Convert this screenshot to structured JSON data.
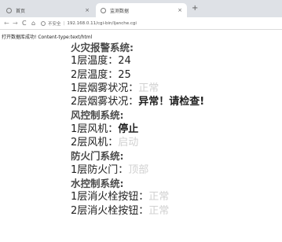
{
  "tabs": [
    {
      "title": "首页",
      "close": "×"
    },
    {
      "title": "监测数据",
      "close": "×"
    }
  ],
  "new_tab": "+",
  "toolbar": {
    "back": "←",
    "forward": "→",
    "reload": "C",
    "home": "⌂",
    "security": "不安全",
    "separator": "|",
    "url": "192.168.0.11/cgi-bin/ljanche.cgi"
  },
  "page": {
    "header": "打开数据库成功! Content-type:text/html",
    "lines": [
      {
        "kind": "section",
        "label": "火灾报警系统:",
        "value": "",
        "style": "normal"
      },
      {
        "kind": "item",
        "label": "1层温度：",
        "value": "24",
        "style": "normal"
      },
      {
        "kind": "item",
        "label": "2层温度：",
        "value": "25",
        "style": "normal"
      },
      {
        "kind": "item",
        "label": "1层烟雾状况：",
        "value": "正常",
        "style": "faint"
      },
      {
        "kind": "item",
        "label": "2层烟雾状况：",
        "value": "异常！请检查!",
        "style": "alert"
      },
      {
        "kind": "section",
        "label": "风控制系统:",
        "value": "",
        "style": "normal"
      },
      {
        "kind": "item",
        "label": "1层风机：",
        "value": "停止",
        "style": "alert"
      },
      {
        "kind": "item",
        "label": "2层风机：",
        "value": "启动",
        "style": "faint"
      },
      {
        "kind": "section",
        "label": "防火门系统:",
        "value": "",
        "style": "normal"
      },
      {
        "kind": "item",
        "label": "1层防火门：",
        "value": "顶部",
        "style": "faint"
      },
      {
        "kind": "section",
        "label": "水控制系统:",
        "value": "",
        "style": "normal"
      },
      {
        "kind": "item",
        "label": "1层消火栓按钮：",
        "value": "正常",
        "style": "faint"
      },
      {
        "kind": "item",
        "label": "2层消火栓按钮：",
        "value": "正常",
        "style": "faint"
      }
    ]
  },
  "colors": {
    "tabstrip": "#dee1e6",
    "text": "#222222",
    "section_text": "#4a4a4a",
    "faint_value": "#d0d0d0"
  },
  "icons": {
    "tab_favicon": "globe-icon",
    "security": "info-icon"
  }
}
